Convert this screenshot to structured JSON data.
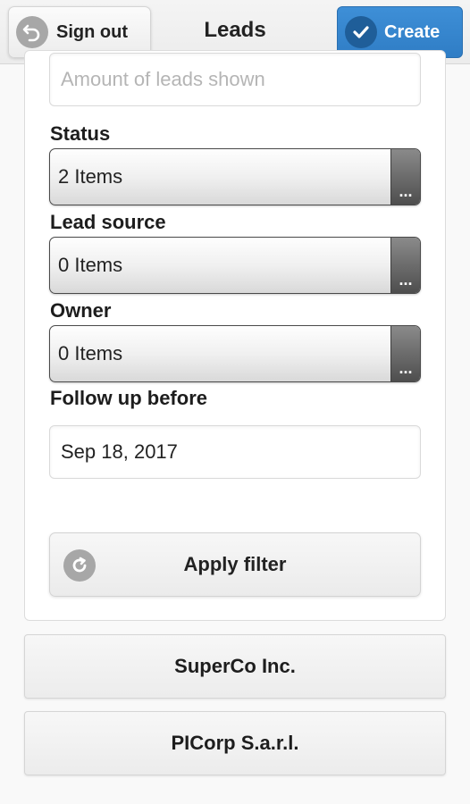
{
  "header": {
    "title": "Leads",
    "signout_label": "Sign out",
    "create_label": "Create"
  },
  "filter": {
    "amount_placeholder": "Amount of leads shown",
    "status": {
      "label": "Status",
      "value": "2 Items",
      "more": "..."
    },
    "lead_source": {
      "label": "Lead source",
      "value": "0 Items",
      "more": "..."
    },
    "owner": {
      "label": "Owner",
      "value": "0 Items",
      "more": "..."
    },
    "follow_up": {
      "label": "Follow up before",
      "value": "Sep 18, 2017"
    },
    "apply_label": "Apply filter"
  },
  "leads": [
    {
      "name": "SuperCo Inc."
    },
    {
      "name": "PICorp S.a.r.l."
    }
  ],
  "colors": {
    "accent": "#3a8ad3",
    "icon_gray": "#a7a7a7"
  }
}
